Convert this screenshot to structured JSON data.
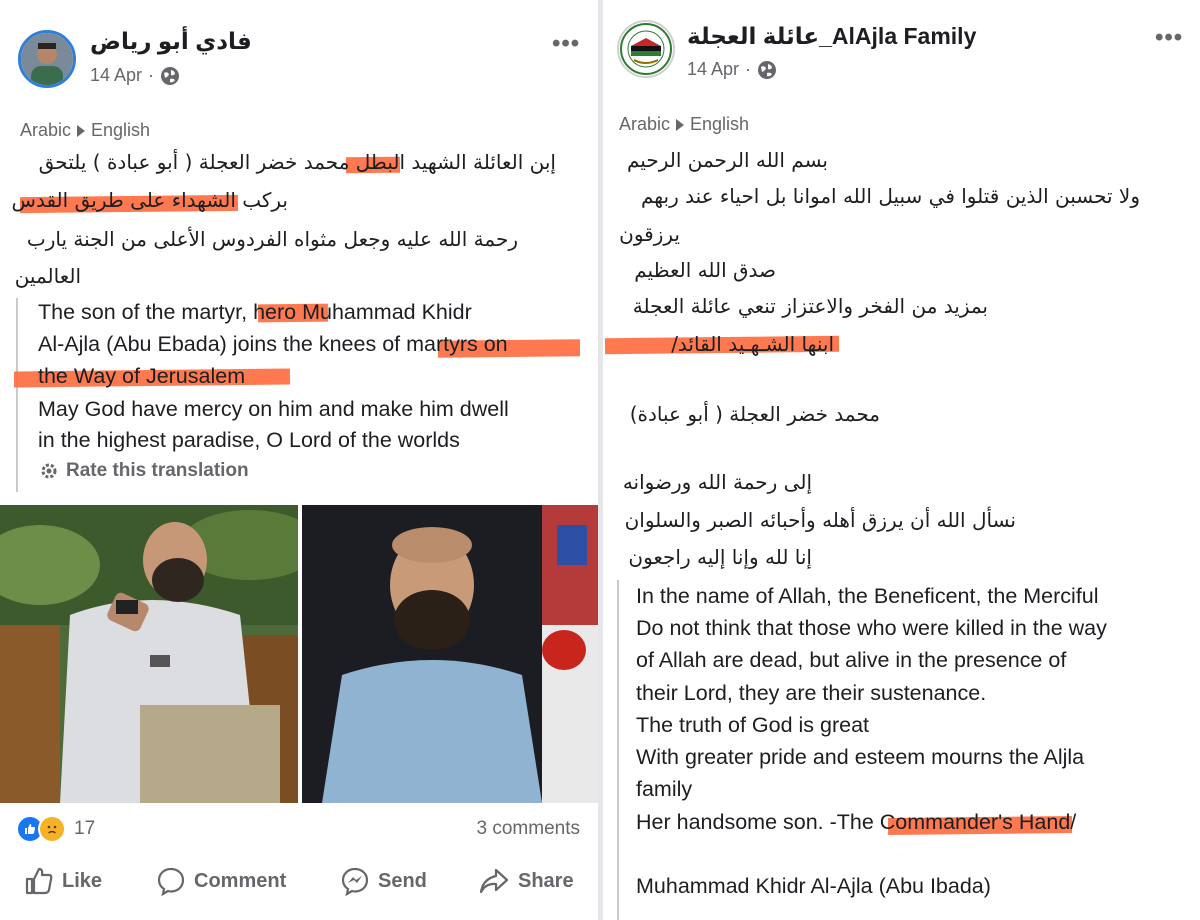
{
  "left_post": {
    "author": "فادي أبو رياض",
    "date": "14 Apr",
    "translation_source": "Arabic",
    "translation_target": "English",
    "arabic_lines": [
      "إبن العائلة الشهيد البطل محمد خضر العجلة ( أبو عبادة ) يلتحق",
      "بركب الشهداء على طريق القدس",
      "رحمة الله عليه وجعل مثواه الفردوس الأعلى من الجنة يارب",
      "العالمين"
    ],
    "english_lines": [
      "The son of the martyr, hero Muhammad Khidr",
      "Al-Ajla (Abu Ebada) joins the knees of martyrs on",
      "the Way of Jerusalem",
      "May God have mercy on him and make him dwell",
      "in the highest paradise, O Lord of the worlds"
    ],
    "rate_label": "Rate this translation",
    "reaction_count": "17",
    "comments_label": "3 comments",
    "actions": {
      "like": "Like",
      "comment": "Comment",
      "send": "Send",
      "share": "Share"
    }
  },
  "right_post": {
    "author": "عائلة العجلة_AlAjla Family",
    "date": "14 Apr",
    "translation_source": "Arabic",
    "translation_target": "English",
    "arabic_lines": [
      "بسم الله الرحمن الرحيم",
      "ولا تحسبن الذين قتلوا في سبيل الله اموانا بل احياء عند ربهم",
      "يرزقون",
      "صدق الله العظيم",
      "بمزيد من الفخر والاعتزاز تنعي عائلة العجلة",
      "ابنها الشـهـيد القائد/",
      "",
      "محمد خضر العجلة ( أبو عبادة)",
      "",
      "إلى رحمة الله ورضوانه",
      "نسأل الله أن يرزق أهله وأحبائه الصبر والسلوان",
      "إنا لله وإنا إليه راجعون"
    ],
    "english_lines": [
      "In the name of Allah, the Beneficent, the Merciful",
      "Do not think that those who were killed in the way",
      "of Allah are dead, but alive in the presence of",
      "their Lord, they are their sustenance.",
      "The truth of God is great",
      "With greater pride and esteem mourns the Aljla",
      "family",
      "Her handsome son. -The Commander's Hand/",
      "",
      "Muhammad Khidr Al-Ajla (Abu Ibada)"
    ]
  },
  "colors": {
    "highlight": "#ff6a3d",
    "muted_text": "#65676b",
    "like_blue": "#1877f2",
    "sad_yellow": "#f7b125"
  }
}
